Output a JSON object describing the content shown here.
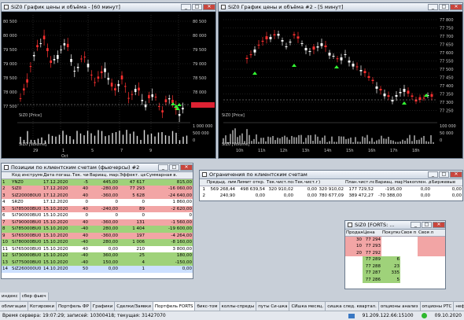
{
  "win1": {
    "title": "SiZ0 График цены и объёма - [60 минут]",
    "price_label": "SiZ0 [Price]",
    "volume_label": "SiZ0 [Volume]",
    "y_labels": [
      "80 500",
      "80 000",
      "79 500",
      "79 000",
      "78 500",
      "78 000",
      "77 500"
    ],
    "y_right": [
      "80 500",
      "80 000",
      "79 500",
      "79 000",
      "78 500",
      "78 000",
      "77 500"
    ],
    "x_labels": [
      "29",
      "1",
      "5",
      "7",
      "9"
    ],
    "x_month": "Oct",
    "vol_labels": [
      "1 000 000",
      "500 000",
      "0"
    ]
  },
  "win2": {
    "title": "SiZ0 График цены и объёма #2 - [5 минут]",
    "price_label": "SiZ0 [Price]",
    "volume_label": "SiZ0 [Volume]",
    "y_labels": [
      "77 800",
      "77 750",
      "77 700",
      "77 650",
      "77 600",
      "77 550",
      "77 500",
      "77 450",
      "77 400",
      "77 350",
      "77 300",
      "77 250"
    ],
    "x_labels": [
      "10h",
      "11h",
      "12h",
      "13h",
      "14h",
      "15h",
      "16h",
      "17h",
      "18h"
    ],
    "vol_labels": [
      "100 000",
      "50 000",
      "0"
    ]
  },
  "positions": {
    "title": "Позиции по клиентским счетам (фьючерсы) #2",
    "headers": [
      "",
      "Код инструмента",
      "Дата погаш.",
      "Тек. чист.",
      "Вариац. маржа",
      "Эффект. цена",
      "Суммарная в."
    ],
    "rows": [
      {
        "n": "1",
        "code": "YNZ0",
        "date": "17.12.2020",
        "pos": "-5",
        "vm": "445,00",
        "price": "47 617",
        "sum": "815,00",
        "c": "g"
      },
      {
        "n": "2",
        "code": "SiZ0",
        "date": "17.12.2020",
        "pos": "40",
        "vm": "-280,00",
        "price": "77 293",
        "sum": "-16 060,00",
        "c": "r"
      },
      {
        "n": "3",
        "code": "SiZ200080U0",
        "date": "17.12.2020",
        "pos": "40",
        "vm": "-360,00",
        "price": "5 628",
        "sum": "-24 640,00",
        "c": "r"
      },
      {
        "n": "4",
        "code": "SRZ0",
        "date": "17.12.2020",
        "pos": "0",
        "vm": "0",
        "price": "0",
        "sum": "1 860,00",
        "c": "n"
      },
      {
        "n": "5",
        "code": "Si785000BU0",
        "date": "15.10.2020",
        "pos": "40",
        "vm": "-240,00",
        "price": "89",
        "sum": "-2 620,00",
        "c": "r"
      },
      {
        "n": "6",
        "code": "Si790000BU0",
        "date": "15.10.2020",
        "pos": "0",
        "vm": "0",
        "price": "0",
        "sum": "0",
        "c": "n"
      },
      {
        "n": "7",
        "code": "Si790000BU0",
        "date": "15.10.2020",
        "pos": "40",
        "vm": "-360,00",
        "price": "131",
        "sum": "-1 560,00",
        "c": "r"
      },
      {
        "n": "8",
        "code": "Si785000BU0",
        "date": "15.10.2020",
        "pos": "-40",
        "vm": "280,00",
        "price": "1 404",
        "sum": "-19 600,00",
        "c": "g"
      },
      {
        "n": "9",
        "code": "Si765000BU0",
        "date": "15.10.2020",
        "pos": "40",
        "vm": "-360,00",
        "price": "197",
        "sum": "-4 264,00",
        "c": "r"
      },
      {
        "n": "10",
        "code": "Si780000BU0",
        "date": "15.10.2020",
        "pos": "-40",
        "vm": "280,00",
        "price": "1 006",
        "sum": "-8 160,00",
        "c": "g"
      },
      {
        "n": "11",
        "code": "Si765000BU0",
        "date": "15.10.2020",
        "pos": "40",
        "vm": "0,00",
        "price": "210",
        "sum": "3 800,00",
        "c": "n"
      },
      {
        "n": "12",
        "code": "Si730000BU0",
        "date": "15.10.2020",
        "pos": "-40",
        "vm": "360,00",
        "price": "25",
        "sum": "180,00",
        "c": "g"
      },
      {
        "n": "13",
        "code": "Si775000BU0",
        "date": "15.10.2020",
        "pos": "-40",
        "vm": "150,00",
        "price": "4",
        "sum": "-150,00",
        "c": "g"
      },
      {
        "n": "14",
        "code": "SiZ260000U0",
        "date": "14.10.2020",
        "pos": "50",
        "vm": "0,00",
        "price": "1",
        "sum": "0,00",
        "c": "s"
      }
    ]
  },
  "limits": {
    "title": "Ограничения по клиентским счетам",
    "headers": [
      "",
      "Предыд. лимит",
      "Лимит откр. п.",
      "Тек.чист.поз.",
      "Тек.чист.поз. (",
      ")",
      "План.чист.поз.",
      "Вариац. маржа",
      "Накоплен. д.",
      "Биржевые"
    ],
    "rows": [
      [
        "1",
        "569 268,44",
        "498 639,54",
        "320 910,02",
        "0,00",
        "320 910,02",
        "177 729,52",
        "-195,00",
        "0,00",
        "0,00"
      ],
      [
        "2",
        "240,90",
        "0,00",
        "0,00",
        "0,00",
        "780 677,09",
        "389 472,27",
        "-70 388,00",
        "0,00",
        "0,00"
      ]
    ]
  },
  "depth": {
    "title": "SiZ0 [FORTS: ...",
    "headers": [
      "Продаж",
      "Цена",
      "Покупка",
      "Своя п",
      "Своя л"
    ],
    "rows": [
      {
        "sell": "30",
        "price": "77 294",
        "buy": "",
        "c": "s"
      },
      {
        "sell": "10",
        "price": "77 293",
        "buy": "",
        "c": "s"
      },
      {
        "sell": "20",
        "price": "77 292",
        "buy": "",
        "c": "s"
      },
      {
        "sell": "",
        "price": "77 289",
        "buy": "6",
        "c": "b"
      },
      {
        "sell": "",
        "price": "77 288",
        "buy": "23",
        "c": "b"
      },
      {
        "sell": "",
        "price": "77 287",
        "buy": "335",
        "c": "b"
      },
      {
        "sell": "",
        "price": "77 286",
        "buy": "5",
        "c": "b"
      }
    ]
  },
  "bottom_small": [
    "индекс",
    "сбер фьюч"
  ],
  "tabs": [
    "облигации",
    "Котировки",
    "Портфель ФР",
    "Графики",
    "Сделки/Заявки",
    "Портфель FORTS",
    "бикс-том",
    "коллы-спреды",
    "путы Си-шка",
    "СИшка месяц.",
    "сишка след. квартал.",
    "опционы анализ",
    "опционы РТС",
    "нефть-"
  ],
  "active_tab": "Портфель FORTS",
  "status": {
    "server_time": "Время сервера: 19:07:29; записей: 10300418; текущая: 31427070",
    "ip": "91.209.122.66:15100",
    "date": "09.10.2020"
  },
  "colors": {
    "candle_up": "#ffffff",
    "candle_down": "#ff3030",
    "signal": "#33ff33",
    "chart_bg": "#000000"
  }
}
